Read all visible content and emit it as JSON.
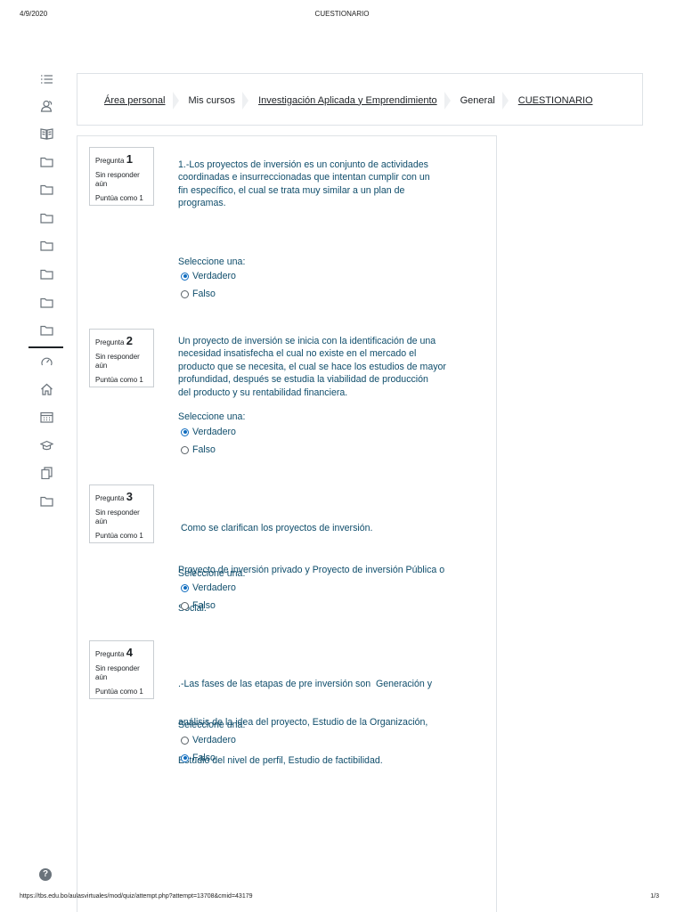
{
  "print": {
    "date": "4/9/2020",
    "title": "CUESTIONARIO",
    "url": "https://tbs.edu.bo/aulasvirtuales/mod/quiz/attempt.php?attempt=13708&cmid=43179",
    "page": "1/3"
  },
  "sidebar": {
    "icons": [
      "list-icon",
      "users-icon",
      "book-icon",
      "folder-icon",
      "folder-icon",
      "folder-icon",
      "folder-icon",
      "folder-icon",
      "folder-icon",
      "folder-icon",
      "dashboard-icon",
      "home-icon",
      "calendar-icon",
      "graduation-cap-icon",
      "files-icon",
      "folder-icon"
    ],
    "help": "?"
  },
  "breadcrumb": [
    {
      "label": "Área personal",
      "link": true
    },
    {
      "label": "Mis cursos",
      "link": false
    },
    {
      "label": "Investigación Aplicada y Emprendimiento",
      "link": true
    },
    {
      "label": "General",
      "link": false
    },
    {
      "label": "CUESTIONARIO",
      "link": true
    }
  ],
  "questions": [
    {
      "label": "Pregunta",
      "number": "1",
      "state": "Sin responder aún",
      "points": "Puntúa como 1",
      "text": [
        "1.-Los proyectos de inversión es un conjunto de actividades",
        "coordinadas e insurreccionadas que intentan cumplir con un",
        "fin específico, el cual se trata muy similar a un plan de",
        "programas."
      ],
      "prompt": "Seleccione una:",
      "options": [
        {
          "label": "Verdadero",
          "checked": true
        },
        {
          "label": "Falso",
          "checked": false
        }
      ]
    },
    {
      "label": "Pregunta",
      "number": "2",
      "state": "Sin responder aún",
      "points": "Puntúa como 1",
      "text": [
        "Un proyecto de inversión se inicia con la identificación de una",
        "necesidad insatisfecha el cual no existe en el mercado el",
        "producto que se necesita, el cual se hace los estudios de mayor",
        "profundidad, después se estudia la viabilidad de producción",
        "del producto y su rentabilidad financiera."
      ],
      "prompt": "Seleccione una:",
      "options": [
        {
          "label": "Verdadero",
          "checked": true
        },
        {
          "label": "Falso",
          "checked": false
        }
      ]
    },
    {
      "label": "Pregunta",
      "number": "3",
      "state": "Sin responder aún",
      "points": "Puntúa como 1",
      "text": [
        " Como se clarifican los proyectos de inversión.",
        "Proyecto de inversión privado y Proyecto de inversión Pública o",
        "Social."
      ],
      "prompt": "Seleccione una:",
      "options": [
        {
          "label": "Verdadero",
          "checked": true
        },
        {
          "label": "Falso",
          "checked": false
        }
      ]
    },
    {
      "label": "Pregunta",
      "number": "4",
      "state": "Sin responder aún",
      "points": "Puntúa como 1",
      "text": [
        ".-Las fases de las etapas de pre inversión son  Generación y",
        "análisis de la idea del proyecto, Estudio de la Organización,",
        "Estudio del nivel de perfil, Estudio de factibilidad."
      ],
      "prompt": "Seleccione una:",
      "options": [
        {
          "label": "Verdadero",
          "checked": false
        },
        {
          "label": "Falso",
          "checked": true
        }
      ]
    }
  ]
}
